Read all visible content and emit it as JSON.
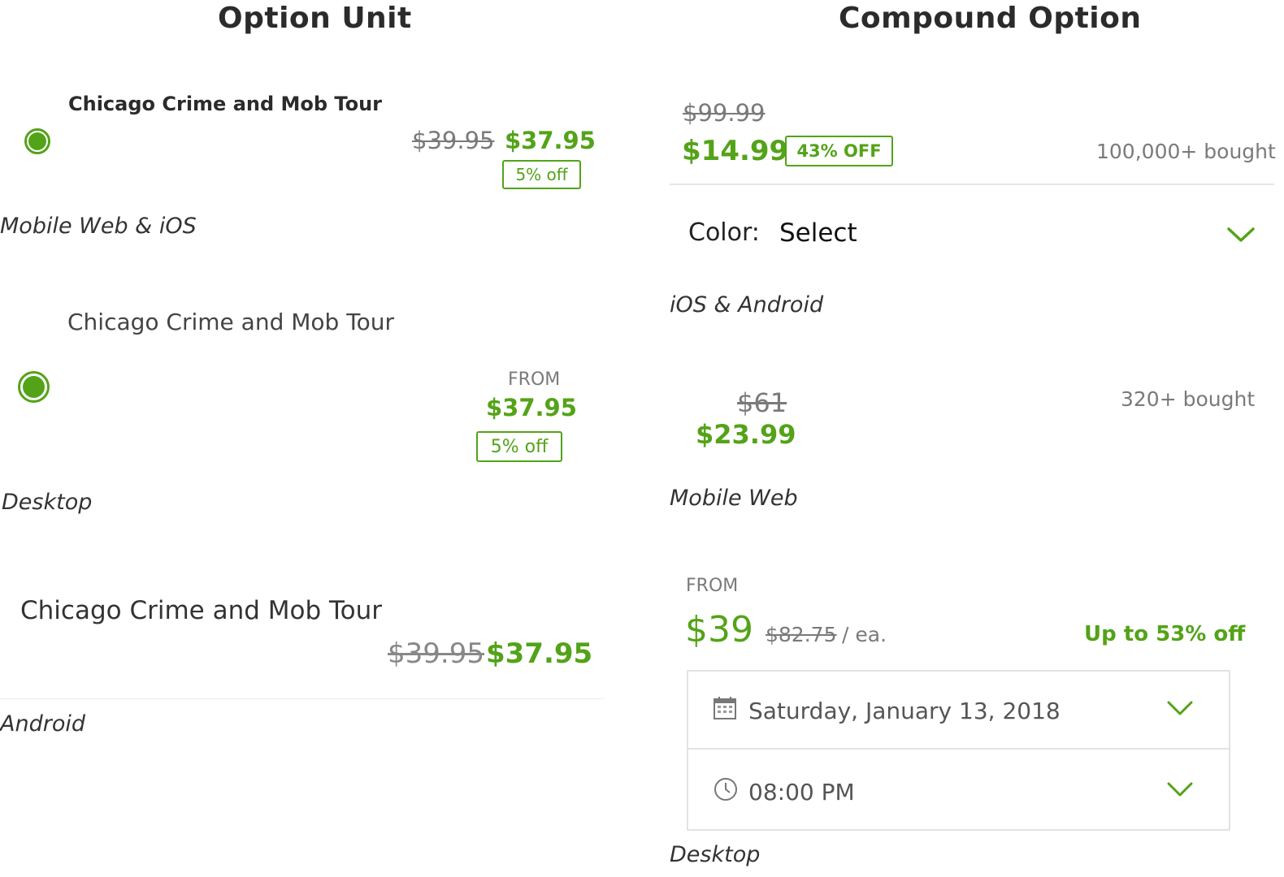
{
  "left": {
    "heading": "Option Unit",
    "mobile_ios": {
      "title": "Chicago Crime and Mob Tour",
      "original_price": "$39.95",
      "price": "$37.95",
      "badge": "5% off",
      "caption": "Mobile Web & iOS"
    },
    "desktop": {
      "title": "Chicago Crime and Mob Tour",
      "from_label": "FROM",
      "price": "$37.95",
      "badge": "5% off",
      "caption": "Desktop"
    },
    "android": {
      "title": "Chicago Crime and Mob Tour",
      "original_price": "$39.95",
      "price": "$37.95",
      "caption": "Android"
    }
  },
  "right": {
    "heading": "Compound Option",
    "ios_android": {
      "original_price": "$99.99",
      "price": "$14.99",
      "badge": "43% OFF",
      "bought": "100,000+ bought",
      "color_label": "Color:",
      "color_value": "Select",
      "caption": "iOS & Android"
    },
    "mobile_web": {
      "original_price": "$61",
      "price": "$23.99",
      "bought": "320+ bought",
      "caption": "Mobile Web"
    },
    "desktop": {
      "from_label": "FROM",
      "price": "$39",
      "original_price": "$82.75",
      "per_unit": "/ ea.",
      "discount": "Up to 53% off",
      "date": "Saturday, January 13, 2018",
      "time": "08:00 PM",
      "caption": "Desktop"
    }
  },
  "colors": {
    "accent": "#53a318",
    "muted": "#7a7a7a",
    "border": "#e3e3e3"
  },
  "icons": [
    "radio-selected-icon",
    "chevron-down-icon",
    "calendar-icon",
    "clock-icon"
  ]
}
